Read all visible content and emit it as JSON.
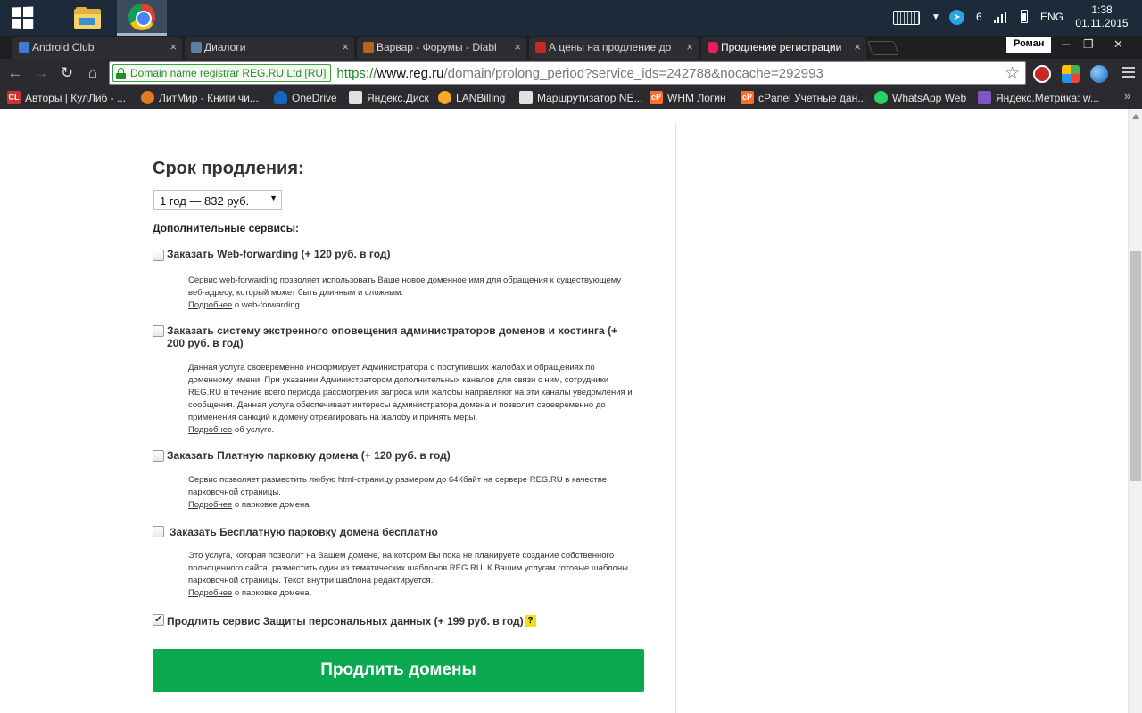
{
  "taskbar": {
    "tray_count": "6",
    "language": "ENG",
    "time": "1:38",
    "date": "01.11.2015"
  },
  "tabs": [
    {
      "label": "Android Club",
      "color": "#3d7bd9"
    },
    {
      "label": "Диалоги",
      "color": "#5b7fa6"
    },
    {
      "label": "Варвар - Форумы - Diabl",
      "color": "#b5651d"
    },
    {
      "label": "А цены на продление до",
      "color": "#c62828"
    },
    {
      "label": "Продление регистрации",
      "color": "#e91e63"
    }
  ],
  "window": {
    "profile": "Роман",
    "minimize": "─",
    "restore": "❐",
    "close": "✕"
  },
  "toolbar": {
    "back": "←",
    "forward": "→",
    "reload": "↻",
    "home": "⌂",
    "ev_label": "Domain name registrar REG.RU Ltd [RU]",
    "url_scheme": "https://",
    "url_host": "www.reg.ru",
    "url_path": "/domain/prolong_period?service_ids=242788&nocache=292993",
    "star": "☆"
  },
  "bookmarks": [
    {
      "label": "Авторы | КулЛиб - ...",
      "icon": "CL",
      "color": "#d32f2f"
    },
    {
      "label": "ЛитМир - Книги чи...",
      "icon": "",
      "color": "#e07b22"
    },
    {
      "label": "OneDrive",
      "icon": "",
      "color": "#1565c0"
    },
    {
      "label": "Яндекс.Диск",
      "icon": "",
      "color": "#9e9e9e"
    },
    {
      "label": "LANBilling",
      "icon": "",
      "color": "#f9a825"
    },
    {
      "label": "Маршрутизатор NE...",
      "icon": "",
      "color": "#9e9e9e"
    },
    {
      "label": "WHM Логин",
      "icon": "cP",
      "color": "#ff6c2c"
    },
    {
      "label": "cPanel Учетные дан...",
      "icon": "cP",
      "color": "#ff6c2c"
    },
    {
      "label": "WhatsApp Web",
      "icon": "",
      "color": "#25d366"
    },
    {
      "label": "Яндекс.Метрика: w...",
      "icon": "",
      "color": "#7e57c2"
    }
  ],
  "bookmarks_more": "»",
  "form": {
    "title": "Срок продления:",
    "period_selected": "1 год — 832 руб.",
    "additional_label": "Дополнительные сервисы:",
    "options": [
      {
        "label": "Заказать Web-forwarding (+ 120 руб. в год)",
        "checked": false,
        "desc": "Сервис web-forwarding позволяет использовать Ваше новое доменное имя для обращения к существующему веб-адресу, который может быть длинным и сложным.",
        "more_link": "Подробнее",
        "more_tail": " о web-forwarding."
      },
      {
        "label": "Заказать систему экстренного оповещения администраторов доменов и хостинга (+ 200 руб. в год)",
        "checked": false,
        "desc": "Данная услуга своевременно информирует Администратора о поступивших жалобах и обращениях по доменному имени. При указании Администратором дополнительных каналов для связи с ним, сотрудники REG.RU в течение всего периода рассмотрения запроса или жалобы направляют на эти каналы уведомления и сообщения. Данная услуга обеспечивает интересы администратора домена и позволит своевременно до применения санкций к домену отреагировать на жалобу и принять меры.",
        "more_link": "Подробнее",
        "more_tail": " об услуге."
      },
      {
        "label": "Заказать Платную парковку домена (+ 120 руб. в год)",
        "checked": false,
        "desc": "Сервис позволяет разместить любую html-страницу размером до 64Кбайт на сервере REG.RU в качестве парковочной страницы.",
        "more_link": "Подробнее",
        "more_tail": " о парковке домена."
      },
      {
        "label": "Заказать Бесплатную парковку домена бесплатно",
        "checked": false,
        "desc": "Это услуга, которая позволит на Вашем домене, на котором Вы пока не планируете создание собственного полноценного сайта, разместить один из тематических шаблонов REG.RU. К Вашим услугам готовые шаблоны парковочной страницы. Текст внутри шаблона редактируется.",
        "more_link": "Подробнее",
        "more_tail": " о парковке домена."
      }
    ],
    "privacy_label": "Продлить сервис Защиты персональных данных (+ 199 руб. в год)",
    "privacy_checked": true,
    "help": "?",
    "submit": "Продлить домены"
  }
}
